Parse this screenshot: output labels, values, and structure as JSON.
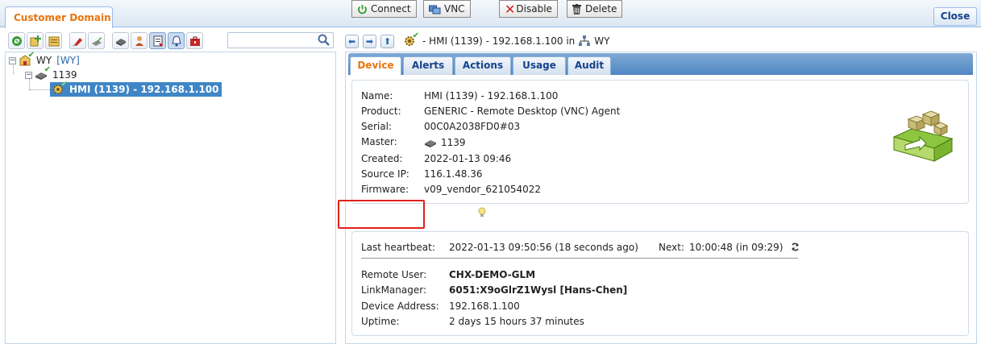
{
  "window": {
    "tab_title": "Customer Domain",
    "close_label": "Close"
  },
  "left_toolbar": {
    "search_placeholder": "",
    "buttons": [
      "refresh-icon",
      "add-domain-icon",
      "domain-properties-icon",
      "flag-icon",
      "edit-icon",
      "device-icon",
      "user-icon",
      "report-icon",
      "alert-icon",
      "toolbox-icon"
    ]
  },
  "tree": {
    "root": {
      "label": "WY",
      "tag": "[WY]"
    },
    "child": {
      "label": "1139"
    },
    "leaf": {
      "label": "HMI (1139) - 192.168.1.100"
    }
  },
  "breadcrumb": {
    "device": "- HMI (1139) - 192.168.1.100 in",
    "domain": "WY"
  },
  "tabs": [
    {
      "label": "Device",
      "active": true
    },
    {
      "label": "Alerts",
      "active": false
    },
    {
      "label": "Actions",
      "active": false
    },
    {
      "label": "Usage",
      "active": false
    },
    {
      "label": "Audit",
      "active": false
    }
  ],
  "device_info": {
    "name_label": "Name:",
    "name": "HMI (1139) - 192.168.1.100",
    "product_label": "Product:",
    "product": "GENERIC - Remote Desktop (VNC) Agent",
    "serial_label": "Serial:",
    "serial": "00C0A2038FD0#03",
    "master_label": "Master:",
    "master": "1139",
    "created_label": "Created:",
    "created": "2022-01-13 09:46",
    "source_ip_label": "Source IP:",
    "source_ip": "116.1.48.36",
    "firmware_label": "Firmware:",
    "firmware": "v09_vendor_621054022"
  },
  "actions": {
    "connect": "Connect",
    "vnc": "VNC",
    "disable": "Disable",
    "delete": "Delete"
  },
  "status": {
    "heartbeat_label": "Last heartbeat:",
    "heartbeat_value": "2022-01-13 09:50:56 (18 seconds ago)",
    "next_label": "Next:",
    "next_value": "10:00:48 (in 09:29)",
    "remote_user_label": "Remote User:",
    "remote_user": "CHX-DEMO-GLM",
    "linkmanager_label": "LinkManager:",
    "linkmanager": "6051:X9oGlrZ1Wysl [Hans-Chen]",
    "device_address_label": "Device Address:",
    "device_address": "192.168.1.100",
    "uptime_label": "Uptime:",
    "uptime": "2 days 15 hours 37 minutes"
  },
  "colors": {
    "accent_orange": "#e8740c",
    "tab_blue": "#15428b",
    "selection_blue": "#3f86c6",
    "highlight_red": "#e0201c",
    "check_green": "#2e9e2e"
  }
}
